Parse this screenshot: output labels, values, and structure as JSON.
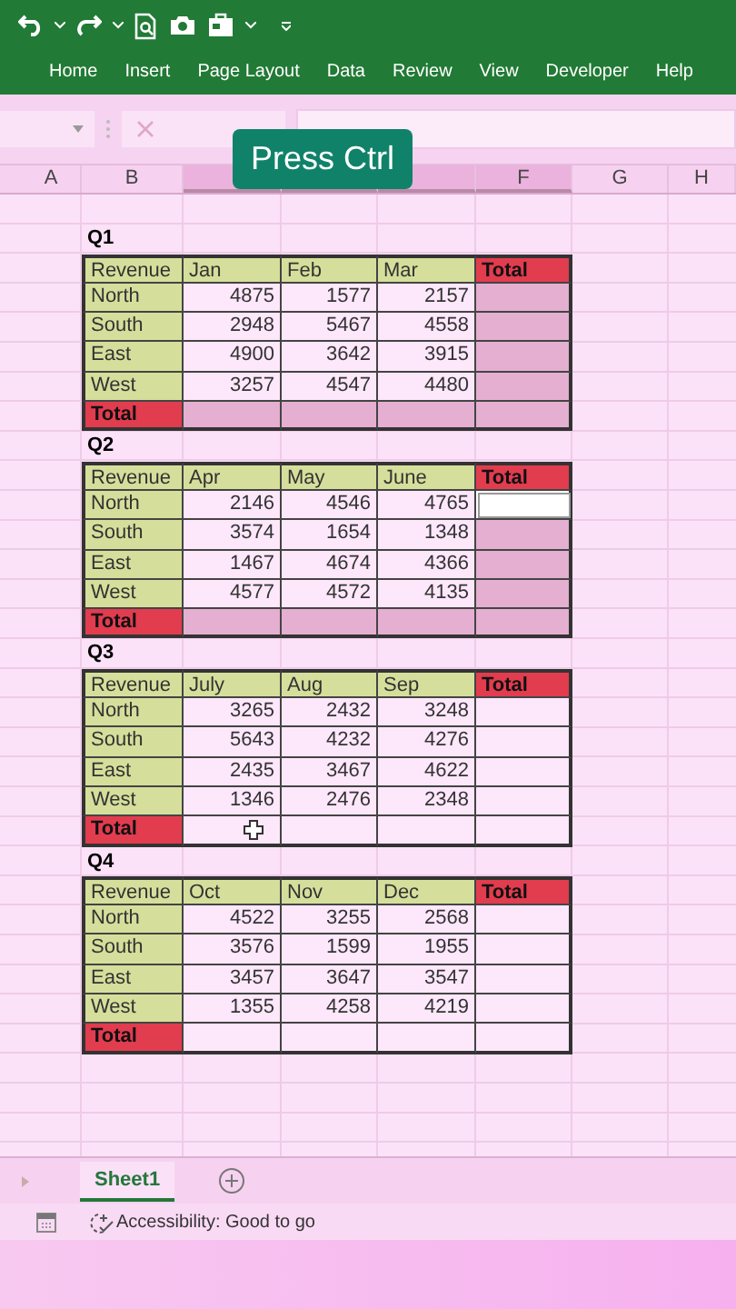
{
  "ribbon": {
    "tabs": [
      {
        "label": "Home",
        "selected": false
      },
      {
        "label": "Insert",
        "selected": false
      },
      {
        "label": "Page Layout",
        "selected": false
      },
      {
        "label": "Data",
        "selected": false
      },
      {
        "label": "Review",
        "selected": false
      },
      {
        "label": "View",
        "selected": false
      },
      {
        "label": "Developer",
        "selected": false
      },
      {
        "label": "Help",
        "selected": false
      }
    ]
  },
  "overlay": {
    "caption": "Press Ctrl"
  },
  "column_headers": [
    {
      "label": "A",
      "selected": false
    },
    {
      "label": "B",
      "selected": false
    },
    {
      "selected": true
    },
    {
      "selected": true
    },
    {
      "selected": true
    },
    {
      "label": "F",
      "selected": true
    },
    {
      "label": "G",
      "selected": false
    },
    {
      "label": "H",
      "selected": false
    }
  ],
  "quarters": [
    {
      "title": "Q1",
      "corner": "Revenue",
      "months": [
        "Jan",
        "Feb",
        "Mar"
      ],
      "total_header": "Total",
      "total_label": "Total",
      "highlighted": true,
      "cursor_in_total_row": false,
      "rows": [
        {
          "region": "North",
          "values": [
            "4875",
            "1577",
            "2157"
          ],
          "total_selected": false
        },
        {
          "region": "South",
          "values": [
            "2948",
            "5467",
            "4558"
          ],
          "total_selected": false
        },
        {
          "region": "East",
          "values": [
            "4900",
            "3642",
            "3915"
          ],
          "total_selected": false
        },
        {
          "region": "West",
          "values": [
            "3257",
            "4547",
            "4480"
          ],
          "total_selected": false
        }
      ]
    },
    {
      "title": "Q2",
      "corner": "Revenue",
      "months": [
        "Apr",
        "May",
        "June"
      ],
      "total_header": "Total",
      "total_label": "Total",
      "highlighted": true,
      "cursor_in_total_row": false,
      "rows": [
        {
          "region": "North",
          "values": [
            "2146",
            "4546",
            "4765"
          ],
          "total_selected": true
        },
        {
          "region": "South",
          "values": [
            "3574",
            "1654",
            "1348"
          ],
          "total_selected": false
        },
        {
          "region": "East",
          "values": [
            "1467",
            "4674",
            "4366"
          ],
          "total_selected": false
        },
        {
          "region": "West",
          "values": [
            "4577",
            "4572",
            "4135"
          ],
          "total_selected": false
        }
      ]
    },
    {
      "title": "Q3",
      "corner": "Revenue",
      "months": [
        "July",
        "Aug",
        "Sep"
      ],
      "total_header": "Total",
      "total_label": "Total",
      "highlighted": false,
      "cursor_in_total_row": true,
      "rows": [
        {
          "region": "North",
          "values": [
            "3265",
            "2432",
            "3248"
          ],
          "total_selected": false
        },
        {
          "region": "South",
          "values": [
            "5643",
            "4232",
            "4276"
          ],
          "total_selected": false
        },
        {
          "region": "East",
          "values": [
            "2435",
            "3467",
            "4622"
          ],
          "total_selected": false
        },
        {
          "region": "West",
          "values": [
            "1346",
            "2476",
            "2348"
          ],
          "total_selected": false
        }
      ]
    },
    {
      "title": "Q4",
      "corner": "Revenue",
      "months": [
        "Oct",
        "Nov",
        "Dec"
      ],
      "total_header": "Total",
      "total_label": "Total",
      "highlighted": false,
      "cursor_in_total_row": false,
      "rows": [
        {
          "region": "North",
          "values": [
            "4522",
            "3255",
            "2568"
          ],
          "total_selected": false
        },
        {
          "region": "South",
          "values": [
            "3576",
            "1599",
            "1955"
          ],
          "total_selected": false
        },
        {
          "region": "East",
          "values": [
            "3457",
            "3647",
            "3547"
          ],
          "total_selected": false
        },
        {
          "region": "West",
          "values": [
            "1355",
            "4258",
            "4219"
          ],
          "total_selected": false
        }
      ]
    }
  ],
  "sheet_tabs": [
    {
      "label": "Sheet1",
      "selected": true
    }
  ],
  "status_bar": {
    "accessibility": "Accessibility: Good to go"
  }
}
